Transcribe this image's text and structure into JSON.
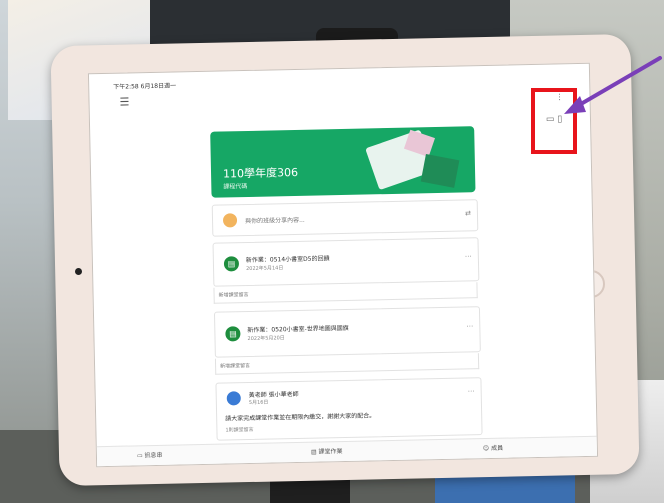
{
  "screen": {
    "status_bar": "下午2:58 6月18日週一",
    "class_title": "110學年度306",
    "class_subtitle": "課程代碼",
    "announce_text": "與你的班級分享內容...",
    "assignments": [
      {
        "title": "新作業：0514小書室D5的回饋",
        "sub": "2022年5月14日"
      },
      {
        "title": "新作業：0520小書室-世界地圖與國旗",
        "sub": "2022年5月20日"
      }
    ],
    "comment_placeholder": "新增課堂留言",
    "post": {
      "author": "黃老師 張小華老師",
      "date": "5月16日",
      "body": "請大家完成課堂作業並在期限內繳交，謝謝大家的配合。",
      "comment": "1則課堂留言"
    },
    "nav": [
      "訊息串",
      "課堂作業",
      "成員"
    ]
  },
  "colors": {
    "banner": "#16a765",
    "highlight": "#e8141b",
    "arrow": "#7a3fb8"
  }
}
